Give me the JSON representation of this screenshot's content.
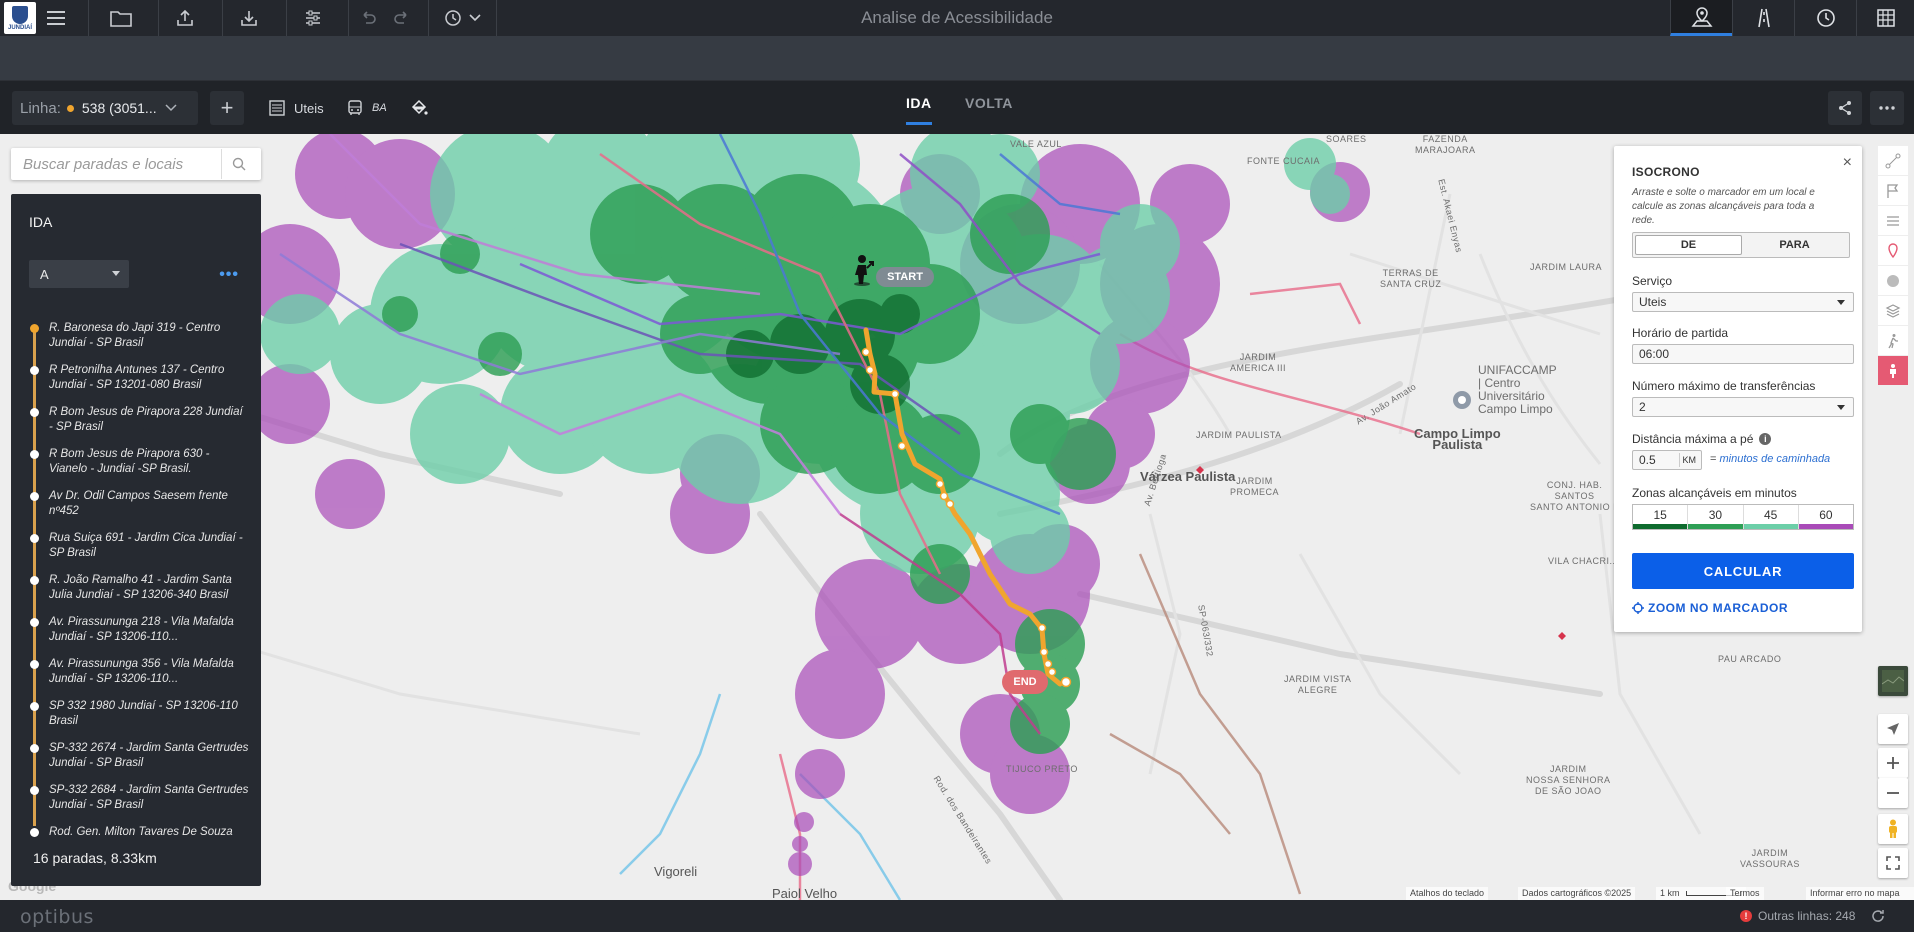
{
  "header": {
    "title": "Analise de Acessibilidade",
    "logo_text": "JUNDIAÍ"
  },
  "linebar": {
    "line_label": "Linha:",
    "line_value": "538 (3051...",
    "add_label": "+",
    "calendar_label": "Uteis",
    "vehicle_label": "BA",
    "tabs": [
      {
        "label": "IDA",
        "active": true
      },
      {
        "label": "VOLTA",
        "active": false
      }
    ]
  },
  "search": {
    "placeholder": "Buscar paradas e locais"
  },
  "route_panel": {
    "title": "IDA",
    "variant": "A",
    "more": "•••",
    "stops": [
      "R. Baronesa do Japi 319 - Centro Jundiaí - SP Brasil",
      "R Petronilha Antunes 137 - Centro Jundiaí - SP 13201-080 Brasil",
      "R Bom Jesus de Pirapora 228 Jundiaí - SP Brasil",
      "R Bom Jesus de Pirapora 630 - Vianelo - Jundiaí -SP Brasil.",
      "Av Dr. Odil Campos Saesem frente nº452",
      "Rua Suiça 691 - Jardim Cica Jundiaí - SP Brasil",
      "R. João Ramalho 41 - Jardim Santa Julia Jundiaí - SP 13206-340 Brasil",
      "Av. Pirassununga 218 - Vila Mafalda Jundiaí - SP 13206-110...",
      "Av. Pirassununga 356 - Vila Mafalda Jundiaí - SP 13206-110...",
      "SP 332 1980 Jundiaí - SP 13206-110 Brasil",
      "SP-332 2674 - Jardim Santa Gertrudes Jundiaí - SP Brasil",
      "SP-332 2684 - Jardim Santa Gertrudes Jundiaí - SP Brasil",
      "Rod. Gen. Milton Tavares De Souza"
    ],
    "summary": "16 paradas, 8.33km"
  },
  "isochrone": {
    "title": "ISOCRONO",
    "close": "×",
    "description": "Arraste e solte o marcador em um local e calcule as zonas alcançáveis para toda a rede.",
    "direction_options": [
      "DE",
      "PARA"
    ],
    "direction_selected": "DE",
    "service_label": "Serviço",
    "service_value": "Uteis",
    "departure_label": "Horário de partida",
    "departure_value": "06:00",
    "transfers_label": "Número máximo de transferências",
    "transfers_value": "2",
    "walk_label": "Distância máxima a pé",
    "walk_value": "0.5",
    "walk_unit": "KM",
    "walk_note_prefix": "=",
    "walk_note": "minutos de caminhada",
    "zones_label": "Zonas alcançáveis em minutos",
    "zones": [
      {
        "minutes": "15",
        "color": "#0e6b2e"
      },
      {
        "minutes": "30",
        "color": "#2e9f55"
      },
      {
        "minutes": "45",
        "color": "#6ccfa8"
      },
      {
        "minutes": "60",
        "color": "#a94bb8"
      }
    ],
    "calculate_label": "CALCULAR",
    "zoom_label": "ZOOM NO MARCADOR"
  },
  "map": {
    "start_label": "START",
    "end_label": "END",
    "google_label": "Google",
    "labels": {
      "vale_azul": "VALE AZUL",
      "fazenda_marajoara": "FAZENDA\nMARAJOARA",
      "soares": "SOARES",
      "fonte_cucaia": "FONTE CUCAIA",
      "jardim_laura": "JARDIM LAURA",
      "terras_santa_cruz": "TERRAS DE\nSANTA CRUZ",
      "jardim_america": "JARDIM\nAMERICA III",
      "unifaccamp": "UNIFACCAMP\n| Centro\nUniversitário\nCampo Limpo",
      "campo_limpo": "Campo Limpo\nPaulista",
      "jardim_paulista": "JARDIM PAULISTA",
      "varzea_paulista": "Várzea Paulista",
      "jardim_promeca": "JARDIM\nPROMECA",
      "conj_hab": "CONJ. HAB.\nSANTOS\nSANTO ANTONIO II",
      "vila_chacrinha": "VILA CHACRI...",
      "pau_arcado": "PAU ARCADO",
      "jardim_vista_alegre": "JARDIM VISTA\nALEGRE",
      "jardim_nossa_senhora": "JARDIM\nNOSSA SENHORA\nDE SÃO JOAO",
      "jardim_vassouras": "JARDIM\nVASSOURAS",
      "tijuco_preto": "TIJUCO PRETO",
      "vigoreli": "Vigoreli",
      "paiol_velho": "Paiol Velho",
      "rod_bandeirantes": "Rod. dos Bandeirantes",
      "sp_road": "SP-063/332",
      "av_bertioga": "Av. Bertioga",
      "av_joao_amato": "Av. João Amato",
      "est_akaei": "Est. Akaei Enyas"
    },
    "attribution": {
      "shortcuts": "Atalhos do teclado",
      "data": "Dados cartográficos ©2025",
      "scale": "1 km",
      "terms": "Termos",
      "report": "Informar erro no mapa"
    }
  },
  "footer": {
    "brand": "optibus",
    "other_lines": "Outras linhas: 248"
  },
  "colors": {
    "accent": "#2f7fe0",
    "route": "#f0a52e",
    "calculate": "#0b5fe8"
  }
}
